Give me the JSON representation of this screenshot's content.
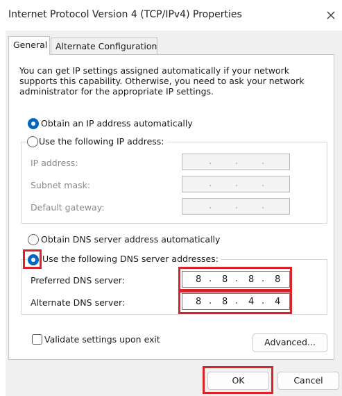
{
  "window": {
    "title": "Internet Protocol Version 4 (TCP/IPv4) Properties"
  },
  "tabs": [
    {
      "label": "General"
    },
    {
      "label": "Alternate Configuration"
    }
  ],
  "general": {
    "description": "You can get IP settings assigned automatically if your network supports this capability. Otherwise, you need to ask your network administrator for the appropriate IP settings.",
    "ip_auto_label": "Obtain an IP address automatically",
    "ip_manual_label": "Use the following IP address:",
    "ip_address_label": "IP address:",
    "subnet_mask_label": "Subnet mask:",
    "default_gateway_label": "Default gateway:",
    "ip_selected": "auto",
    "dns_auto_label": "Obtain DNS server address automatically",
    "dns_manual_label": "Use the following DNS server addresses:",
    "dns_selected": "manual",
    "preferred_dns_label": "Preferred DNS server:",
    "preferred_dns": [
      "8",
      "8",
      "8",
      "8"
    ],
    "alternate_dns_label": "Alternate DNS server:",
    "alternate_dns": [
      "8",
      "8",
      "4",
      "4"
    ],
    "validate_label": "Validate settings upon exit",
    "validate_checked": false,
    "advanced_label": "Advanced..."
  },
  "buttons": {
    "ok": "OK",
    "cancel": "Cancel"
  },
  "colors": {
    "accent": "#0067c0",
    "highlight": "#d9222a"
  }
}
